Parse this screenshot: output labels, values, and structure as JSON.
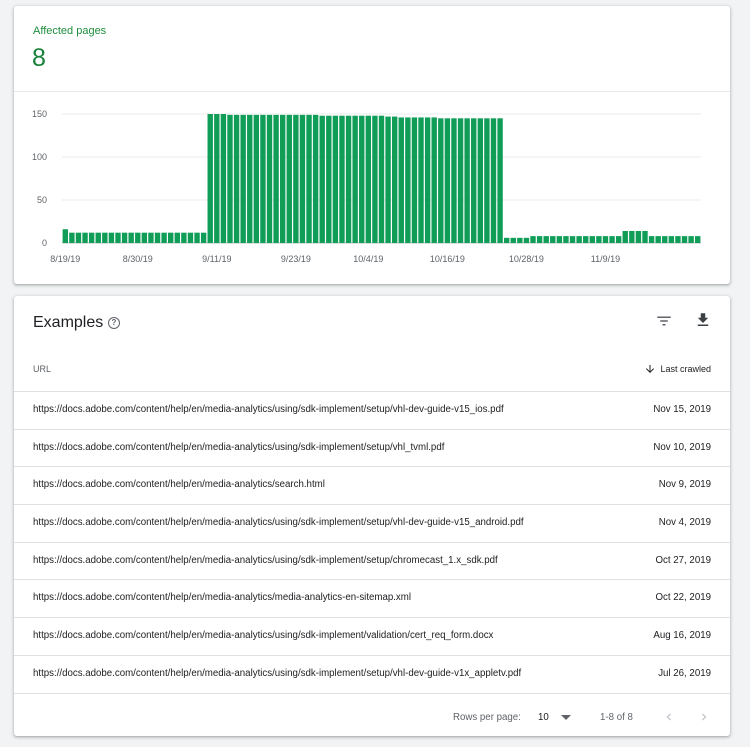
{
  "summary": {
    "label": "Affected pages",
    "value": "8"
  },
  "colors": {
    "bar": "#0f9d58",
    "accent": "#188038"
  },
  "chart_data": {
    "type": "bar",
    "yticks": [
      0,
      50,
      100,
      150
    ],
    "ylim": [
      0,
      150
    ],
    "x_tick_labels": [
      {
        "index": 0,
        "label": "8/19/19"
      },
      {
        "index": 11,
        "label": "8/30/19"
      },
      {
        "index": 23,
        "label": "9/11/19"
      },
      {
        "index": 35,
        "label": "9/23/19"
      },
      {
        "index": 46,
        "label": "10/4/19"
      },
      {
        "index": 58,
        "label": "10/16/19"
      },
      {
        "index": 70,
        "label": "10/28/19"
      },
      {
        "index": 82,
        "label": "11/9/19"
      }
    ],
    "start_date": "8/19/19",
    "values": [
      16,
      12,
      12,
      12,
      12,
      12,
      12,
      12,
      12,
      12,
      12,
      12,
      12,
      12,
      12,
      12,
      12,
      12,
      12,
      12,
      12,
      12,
      150,
      150,
      150,
      149,
      149,
      149,
      149,
      149,
      149,
      149,
      149,
      149,
      149,
      149,
      149,
      149,
      149,
      148,
      148,
      148,
      148,
      148,
      148,
      148,
      148,
      148,
      148,
      147,
      147,
      146,
      146,
      146,
      146,
      146,
      146,
      145,
      145,
      145,
      145,
      145,
      145,
      145,
      145,
      145,
      145,
      6,
      6,
      6,
      6,
      8,
      8,
      8,
      8,
      8,
      8,
      8,
      8,
      8,
      8,
      8,
      8,
      8,
      8,
      14,
      14,
      14,
      14,
      8,
      8,
      8,
      8,
      8,
      8,
      8,
      8
    ]
  },
  "examples": {
    "title": "Examples",
    "help_icon": "help-circle-icon",
    "columns": {
      "url": "URL",
      "last_crawled": "Last crawled"
    },
    "rows": [
      {
        "url": "https://docs.adobe.com/content/help/en/media-analytics/using/sdk-implement/setup/vhl-dev-guide-v15_ios.pdf",
        "date": "Nov 15, 2019"
      },
      {
        "url": "https://docs.adobe.com/content/help/en/media-analytics/using/sdk-implement/setup/vhl_tvml.pdf",
        "date": "Nov 10, 2019"
      },
      {
        "url": "https://docs.adobe.com/content/help/en/media-analytics/search.html",
        "date": "Nov 9, 2019"
      },
      {
        "url": "https://docs.adobe.com/content/help/en/media-analytics/using/sdk-implement/setup/vhl-dev-guide-v15_android.pdf",
        "date": "Nov 4, 2019"
      },
      {
        "url": "https://docs.adobe.com/content/help/en/media-analytics/using/sdk-implement/setup/chromecast_1.x_sdk.pdf",
        "date": "Oct 27, 2019"
      },
      {
        "url": "https://docs.adobe.com/content/help/en/media-analytics/media-analytics-en-sitemap.xml",
        "date": "Oct 22, 2019"
      },
      {
        "url": "https://docs.adobe.com/content/help/en/media-analytics/using/sdk-implement/validation/cert_req_form.docx",
        "date": "Aug 16, 2019"
      },
      {
        "url": "https://docs.adobe.com/content/help/en/media-analytics/using/sdk-implement/setup/vhl-dev-guide-v1x_appletv.pdf",
        "date": "Jul 26, 2019"
      }
    ]
  },
  "pager": {
    "rows_per_page_label": "Rows per page:",
    "rows_per_page_value": "10",
    "range": "1-8 of 8"
  }
}
